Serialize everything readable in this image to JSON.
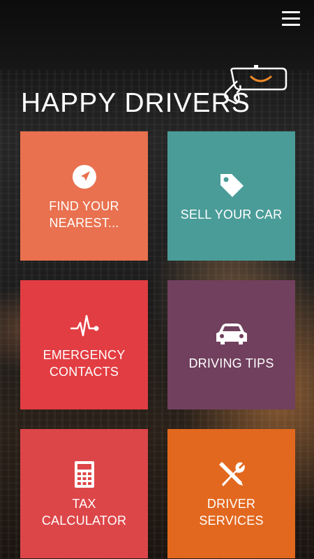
{
  "header": {
    "title": "HAPPY DRIVERS",
    "menu_icon": "hamburger-menu-icon",
    "logo_icon": "rearview-mirror-smile-icon"
  },
  "tiles": [
    {
      "label": "FIND YOUR\nNEAREST...",
      "icon": "navigation-arrow-icon",
      "color": "#e9714f"
    },
    {
      "label": "SELL YOUR CAR",
      "icon": "price-tag-icon",
      "color": "#4a9c98"
    },
    {
      "label": "EMERGENCY\nCONTACTS",
      "icon": "heartbeat-icon",
      "color": "#e23d42"
    },
    {
      "label": "DRIVING TIPS",
      "icon": "car-front-icon",
      "color": "#71405e"
    },
    {
      "label": "TAX\nCALCULATOR",
      "icon": "calculator-icon",
      "color": "#dd4649"
    },
    {
      "label": "DRIVER\nSERVICES",
      "icon": "wrench-screwdriver-icon",
      "color": "#e2681f"
    }
  ]
}
